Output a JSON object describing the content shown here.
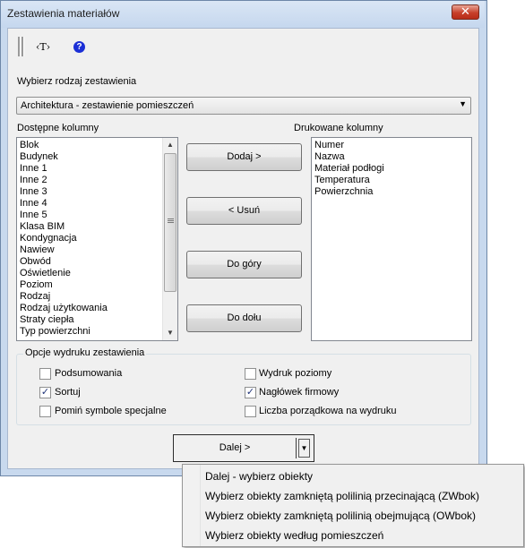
{
  "window": {
    "title": "Zestawienia materiałów",
    "close_label": "✕"
  },
  "toolbar": {
    "text_tool_label": "‹T›",
    "help_label": "?"
  },
  "type_section": {
    "label": "Wybierz rodzaj zestawienia",
    "selected": "Architektura - zestawienie pomieszczeń"
  },
  "available": {
    "label": "Dostępne kolumny",
    "items": [
      "Blok",
      "Budynek",
      "Inne 1",
      "Inne 2",
      "Inne 3",
      "Inne 4",
      "Inne 5",
      "Klasa BIM",
      "Kondygnacja",
      "Nawiew",
      "Obwód",
      "Oświetlenie",
      "Poziom",
      "Rodzaj",
      "Rodzaj użytkowania",
      "Straty ciepła",
      "Typ powierzchni"
    ]
  },
  "printed": {
    "label": "Drukowane kolumny",
    "items": [
      "Numer",
      "Nazwa",
      "Materiał podłogi",
      "Temperatura",
      "Powierzchnia"
    ]
  },
  "buttons": {
    "add": "Dodaj >",
    "remove": "< Usuń",
    "up": "Do góry",
    "down": "Do dołu"
  },
  "options": {
    "title": "Opcje wydruku zestawienia",
    "summary": {
      "label": "Podsumowania",
      "checked": false
    },
    "sort": {
      "label": "Sortuj",
      "checked": true
    },
    "skip_symbols": {
      "label": "Pomiń symbole specjalne",
      "checked": false
    },
    "horizontal": {
      "label": "Wydruk poziomy",
      "checked": false
    },
    "company_header": {
      "label": "Nagłówek firmowy",
      "checked": true
    },
    "ordinal": {
      "label": "Liczba porządkowa na wydruku",
      "checked": false
    }
  },
  "next": {
    "label": "Dalej >"
  },
  "menu": {
    "items": [
      "Dalej - wybierz obiekty",
      "Wybierz obiekty zamkniętą polilinią przecinającą (ZWbok)",
      "Wybierz obiekty zamkniętą polilinią obejmującą (OWbok)",
      "Wybierz obiekty według pomieszczeń"
    ]
  }
}
